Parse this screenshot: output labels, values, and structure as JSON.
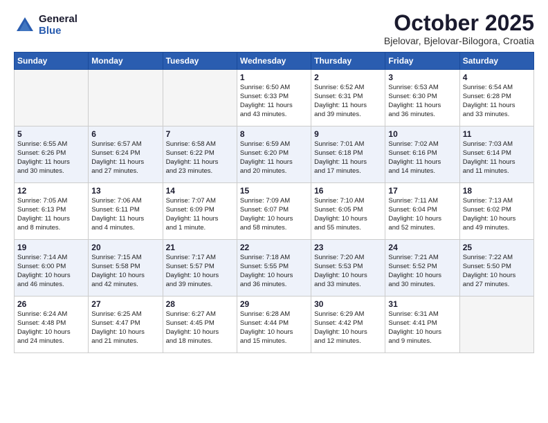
{
  "logo": {
    "general": "General",
    "blue": "Blue"
  },
  "title": "October 2025",
  "location": "Bjelovar, Bjelovar-Bilogora, Croatia",
  "days": [
    "Sunday",
    "Monday",
    "Tuesday",
    "Wednesday",
    "Thursday",
    "Friday",
    "Saturday"
  ],
  "weeks": [
    [
      {
        "day": "",
        "content": ""
      },
      {
        "day": "",
        "content": ""
      },
      {
        "day": "",
        "content": ""
      },
      {
        "day": "1",
        "content": "Sunrise: 6:50 AM\nSunset: 6:33 PM\nDaylight: 11 hours\nand 43 minutes."
      },
      {
        "day": "2",
        "content": "Sunrise: 6:52 AM\nSunset: 6:31 PM\nDaylight: 11 hours\nand 39 minutes."
      },
      {
        "day": "3",
        "content": "Sunrise: 6:53 AM\nSunset: 6:30 PM\nDaylight: 11 hours\nand 36 minutes."
      },
      {
        "day": "4",
        "content": "Sunrise: 6:54 AM\nSunset: 6:28 PM\nDaylight: 11 hours\nand 33 minutes."
      }
    ],
    [
      {
        "day": "5",
        "content": "Sunrise: 6:55 AM\nSunset: 6:26 PM\nDaylight: 11 hours\nand 30 minutes."
      },
      {
        "day": "6",
        "content": "Sunrise: 6:57 AM\nSunset: 6:24 PM\nDaylight: 11 hours\nand 27 minutes."
      },
      {
        "day": "7",
        "content": "Sunrise: 6:58 AM\nSunset: 6:22 PM\nDaylight: 11 hours\nand 23 minutes."
      },
      {
        "day": "8",
        "content": "Sunrise: 6:59 AM\nSunset: 6:20 PM\nDaylight: 11 hours\nand 20 minutes."
      },
      {
        "day": "9",
        "content": "Sunrise: 7:01 AM\nSunset: 6:18 PM\nDaylight: 11 hours\nand 17 minutes."
      },
      {
        "day": "10",
        "content": "Sunrise: 7:02 AM\nSunset: 6:16 PM\nDaylight: 11 hours\nand 14 minutes."
      },
      {
        "day": "11",
        "content": "Sunrise: 7:03 AM\nSunset: 6:14 PM\nDaylight: 11 hours\nand 11 minutes."
      }
    ],
    [
      {
        "day": "12",
        "content": "Sunrise: 7:05 AM\nSunset: 6:13 PM\nDaylight: 11 hours\nand 8 minutes."
      },
      {
        "day": "13",
        "content": "Sunrise: 7:06 AM\nSunset: 6:11 PM\nDaylight: 11 hours\nand 4 minutes."
      },
      {
        "day": "14",
        "content": "Sunrise: 7:07 AM\nSunset: 6:09 PM\nDaylight: 11 hours\nand 1 minute."
      },
      {
        "day": "15",
        "content": "Sunrise: 7:09 AM\nSunset: 6:07 PM\nDaylight: 10 hours\nand 58 minutes."
      },
      {
        "day": "16",
        "content": "Sunrise: 7:10 AM\nSunset: 6:05 PM\nDaylight: 10 hours\nand 55 minutes."
      },
      {
        "day": "17",
        "content": "Sunrise: 7:11 AM\nSunset: 6:04 PM\nDaylight: 10 hours\nand 52 minutes."
      },
      {
        "day": "18",
        "content": "Sunrise: 7:13 AM\nSunset: 6:02 PM\nDaylight: 10 hours\nand 49 minutes."
      }
    ],
    [
      {
        "day": "19",
        "content": "Sunrise: 7:14 AM\nSunset: 6:00 PM\nDaylight: 10 hours\nand 46 minutes."
      },
      {
        "day": "20",
        "content": "Sunrise: 7:15 AM\nSunset: 5:58 PM\nDaylight: 10 hours\nand 42 minutes."
      },
      {
        "day": "21",
        "content": "Sunrise: 7:17 AM\nSunset: 5:57 PM\nDaylight: 10 hours\nand 39 minutes."
      },
      {
        "day": "22",
        "content": "Sunrise: 7:18 AM\nSunset: 5:55 PM\nDaylight: 10 hours\nand 36 minutes."
      },
      {
        "day": "23",
        "content": "Sunrise: 7:20 AM\nSunset: 5:53 PM\nDaylight: 10 hours\nand 33 minutes."
      },
      {
        "day": "24",
        "content": "Sunrise: 7:21 AM\nSunset: 5:52 PM\nDaylight: 10 hours\nand 30 minutes."
      },
      {
        "day": "25",
        "content": "Sunrise: 7:22 AM\nSunset: 5:50 PM\nDaylight: 10 hours\nand 27 minutes."
      }
    ],
    [
      {
        "day": "26",
        "content": "Sunrise: 6:24 AM\nSunset: 4:48 PM\nDaylight: 10 hours\nand 24 minutes."
      },
      {
        "day": "27",
        "content": "Sunrise: 6:25 AM\nSunset: 4:47 PM\nDaylight: 10 hours\nand 21 minutes."
      },
      {
        "day": "28",
        "content": "Sunrise: 6:27 AM\nSunset: 4:45 PM\nDaylight: 10 hours\nand 18 minutes."
      },
      {
        "day": "29",
        "content": "Sunrise: 6:28 AM\nSunset: 4:44 PM\nDaylight: 10 hours\nand 15 minutes."
      },
      {
        "day": "30",
        "content": "Sunrise: 6:29 AM\nSunset: 4:42 PM\nDaylight: 10 hours\nand 12 minutes."
      },
      {
        "day": "31",
        "content": "Sunrise: 6:31 AM\nSunset: 4:41 PM\nDaylight: 10 hours\nand 9 minutes."
      },
      {
        "day": "",
        "content": ""
      }
    ]
  ]
}
